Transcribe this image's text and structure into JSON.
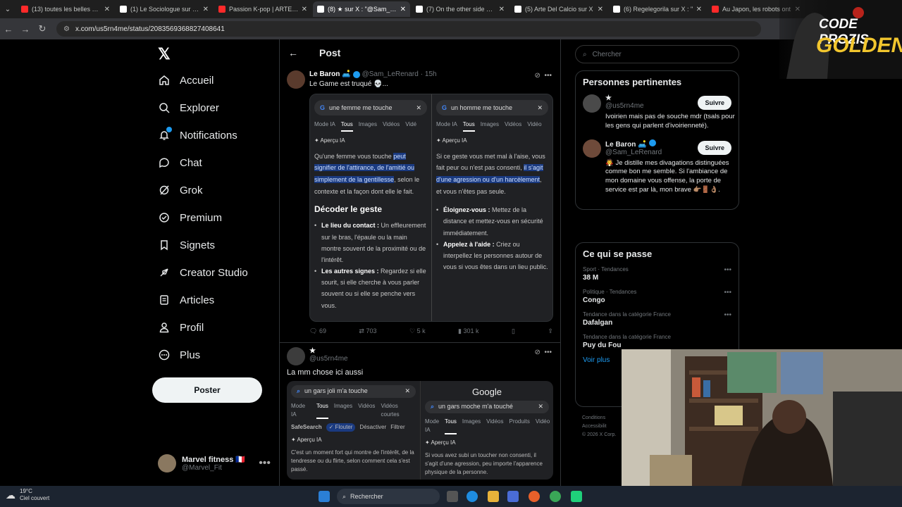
{
  "browser": {
    "tabs": [
      {
        "title": "(13) toutes les belles cho",
        "color": "#ff2a2a",
        "active": false
      },
      {
        "title": "(1) Le Sociologue sur X :",
        "color": "#ffffff",
        "active": false
      },
      {
        "title": "Passion K-pop | ARTE Reg",
        "color": "#ff2a2a",
        "active": false
      },
      {
        "title": "(8) ★ sur X : \"@Sam_LeRe",
        "color": "#ffffff",
        "active": true
      },
      {
        "title": "(7) On the other side of th",
        "color": "#ffffff",
        "active": false
      },
      {
        "title": "(5) Arte Del Calcio sur X",
        "color": "#ffffff",
        "active": false
      },
      {
        "title": "(6) Regelegorila sur X : \"",
        "color": "#ffffff",
        "active": false
      },
      {
        "title": "Au Japon, les robots ont",
        "color": "#ff2a2a",
        "active": false
      }
    ],
    "url": "x.com/us5rn4me/status/2083569368827408641"
  },
  "sidebar": {
    "items": [
      {
        "label": "Accueil",
        "icon": "home-icon"
      },
      {
        "label": "Explorer",
        "icon": "search-icon"
      },
      {
        "label": "Notifications",
        "icon": "bell-icon"
      },
      {
        "label": "Chat",
        "icon": "chat-icon"
      },
      {
        "label": "Grok",
        "icon": "grok-icon"
      },
      {
        "label": "Premium",
        "icon": "premium-icon"
      },
      {
        "label": "Signets",
        "icon": "bookmark-icon"
      },
      {
        "label": "Creator Studio",
        "icon": "rocket-icon"
      },
      {
        "label": "Articles",
        "icon": "article-icon"
      },
      {
        "label": "Profil",
        "icon": "person-icon"
      },
      {
        "label": "Plus",
        "icon": "more-icon"
      }
    ],
    "post_label": "Poster",
    "account": {
      "name": "Marvel fitness 🇫🇷",
      "handle": "@Marvel_Fit"
    }
  },
  "main": {
    "header": "Post",
    "tweet1": {
      "name": "Le Baron 🛋️",
      "handle": "@Sam_LeRenard",
      "time": "· 15h",
      "text": "Le Game est truqué 💀...",
      "left": {
        "query": "une femme me touche",
        "tabs": [
          "Mode IA",
          "Tous",
          "Images",
          "Vidéos",
          "Vidé"
        ],
        "apercu": "✦ Aperçu IA",
        "p_before": "Qu'une femme vous touche ",
        "p_hl": "peut signifier de l'attirance, de l'amitié ou simplement de la gentillesse",
        "p_after": ", selon le contexte et la façon dont elle le fait.",
        "heading": "Décoder le geste",
        "b1_title": "Le lieu du contact :",
        "b1_text": " Un effleurement sur le bras, l'épaule ou la main montre souvent de la proximité ou de l'intérêt.",
        "b2_title": "Les autres signes :",
        "b2_text": " Regardez si elle sourit, si elle cherche à vous parler souvent ou si elle se penche vers vous."
      },
      "right": {
        "query": "un homme me touche",
        "tabs": [
          "Mode IA",
          "Tous",
          "Images",
          "Vidéos",
          "Vidéo"
        ],
        "apercu": "✦ Aperçu IA",
        "p_before": "Si ce geste vous met mal à l'aise, vous fait peur ou n'est pas consenti, ",
        "p_hl": "il s'agit d'une agression ou d'un harcèlement",
        "p_after": ", et vous n'êtes pas seule.",
        "b1_title": "Éloignez-vous :",
        "b1_text": " Mettez de la distance et mettez-vous en sécurité immédiatement.",
        "b2_title": "Appelez à l'aide :",
        "b2_text": " Criez ou interpellez les personnes autour de vous si vous êtes dans un lieu public."
      },
      "stats": {
        "replies": "69",
        "retweets": "703",
        "likes": "5 k",
        "views": "301 k"
      }
    },
    "tweet2": {
      "name": "★",
      "handle": "@us5rn4me",
      "text": "La mm chose ici aussi",
      "left": {
        "query": "un gars joli m'a touche",
        "tabs": [
          "Mode IA",
          "Tous",
          "Images",
          "Vidéos",
          "Vidéos courtes"
        ],
        "safesearch": "SafeSearch",
        "flouter": "✓ Flouter",
        "desactiver": "Désactiver",
        "filtrer": "Filtrer",
        "apercu": "✦ Aperçu IA",
        "text": "C'est un moment fort qui montre de l'intérêt, de la tendresse ou du flirte, selon comment cela s'est passé."
      },
      "right": {
        "brand": "Google",
        "query": "un gars moche m'a touché",
        "tabs": [
          "Mode IA",
          "Tous",
          "Images",
          "Vidéos",
          "Produits",
          "Vidéo"
        ],
        "apercu": "✦ Aperçu IA",
        "text": "Si vous avez subi un toucher non consenti, il s'agit d'une agression, peu importe l'apparence physique de la personne."
      }
    }
  },
  "rightcol": {
    "search_placeholder": "Chercher",
    "relevant_title": "Personnes pertinentes",
    "people": [
      {
        "name": "★",
        "handle": "@us5rn4me",
        "follow": "Suivre",
        "bio": "Ivoirien mais pas de souche mdr (tsals pour les gens qui parlent d'ivoirienneté)."
      },
      {
        "name": "Le Baron 🛋️",
        "handle": "@Sam_LeRenard",
        "follow": "Suivre",
        "bio": "🧛 Je distille mes divagations distinguées comme bon me semble. Si l'ambiance de mon domaine vous offense, la porte de service est par là, mon brave 👉🏽🚪👌🏽."
      }
    ],
    "trends_title": "Ce qui se passe",
    "trends": [
      {
        "category": "Sport · Tendances",
        "name": "38 M"
      },
      {
        "category": "Politique · Tendances",
        "name": "Congo"
      },
      {
        "category": "Tendance dans la catégorie France",
        "name": "Dafalgan"
      },
      {
        "category": "Tendance dans la catégorie France",
        "name": "Puy du Fou"
      }
    ],
    "see_all": "Voir plus",
    "footer": [
      "Conditions",
      "Accessibilit",
      "© 2026 X Corp."
    ]
  },
  "overlay": {
    "line1": "CODE PROZIS",
    "line2": "GOLDENG"
  },
  "taskbar": {
    "temp": "19°C",
    "weather": "Ciel couvert",
    "search": "Rechercher"
  }
}
